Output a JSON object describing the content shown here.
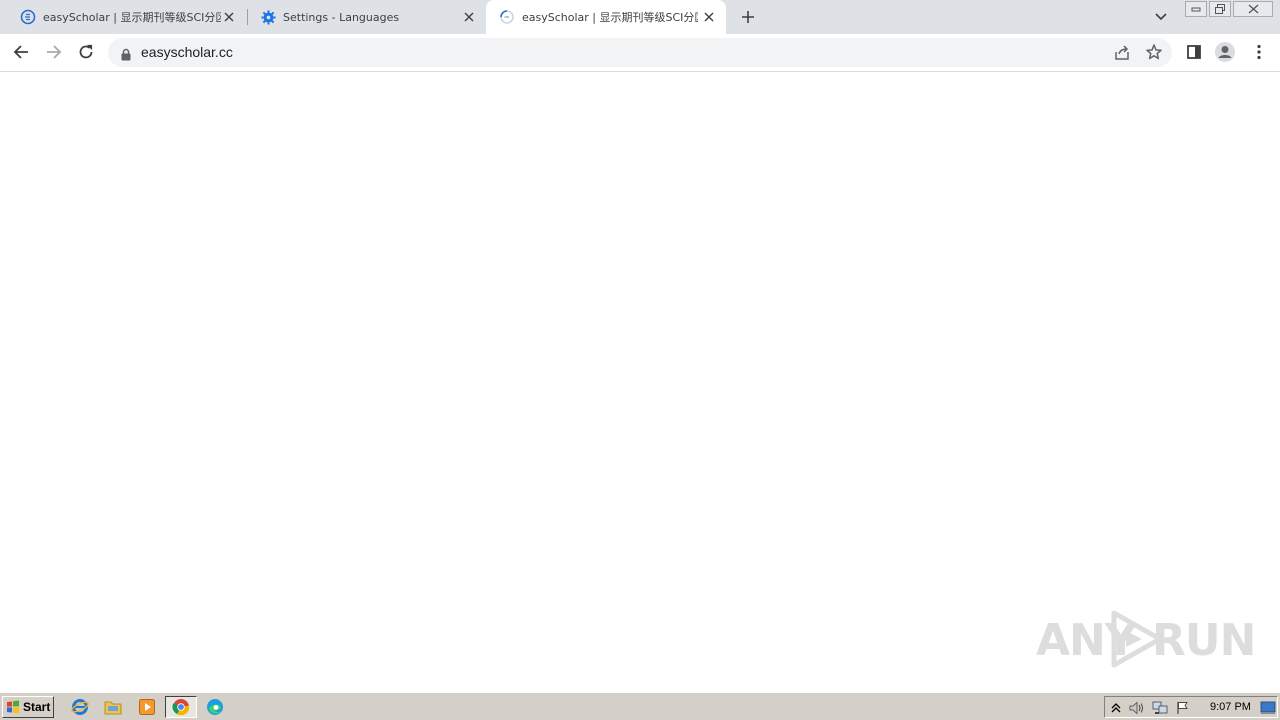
{
  "browser": {
    "tabs": [
      {
        "title": "easyScholar | 显示期刊等级SCI分区",
        "favicon": "easyscholar-favicon",
        "active": false
      },
      {
        "title": "Settings - Languages",
        "favicon": "gear-icon",
        "active": false
      },
      {
        "title": "easyScholar | 显示期刊等级SCI分区",
        "favicon": "loading-favicon",
        "active": true
      }
    ],
    "address": {
      "url": "easyscholar.cc",
      "secure": true
    }
  },
  "watermark": {
    "text_left": "ANY",
    "text_right": "RUN"
  },
  "taskbar": {
    "start_label": "Start",
    "pinned": [
      "internet-explorer-icon",
      "file-explorer-icon",
      "media-player-icon",
      "chrome-icon",
      "edge-icon"
    ],
    "clock": "9:07 PM"
  },
  "colors": {
    "tabstrip": "#dee1e6",
    "omnibox": "#f1f3f4",
    "taskbar": "#d4d0c8"
  }
}
